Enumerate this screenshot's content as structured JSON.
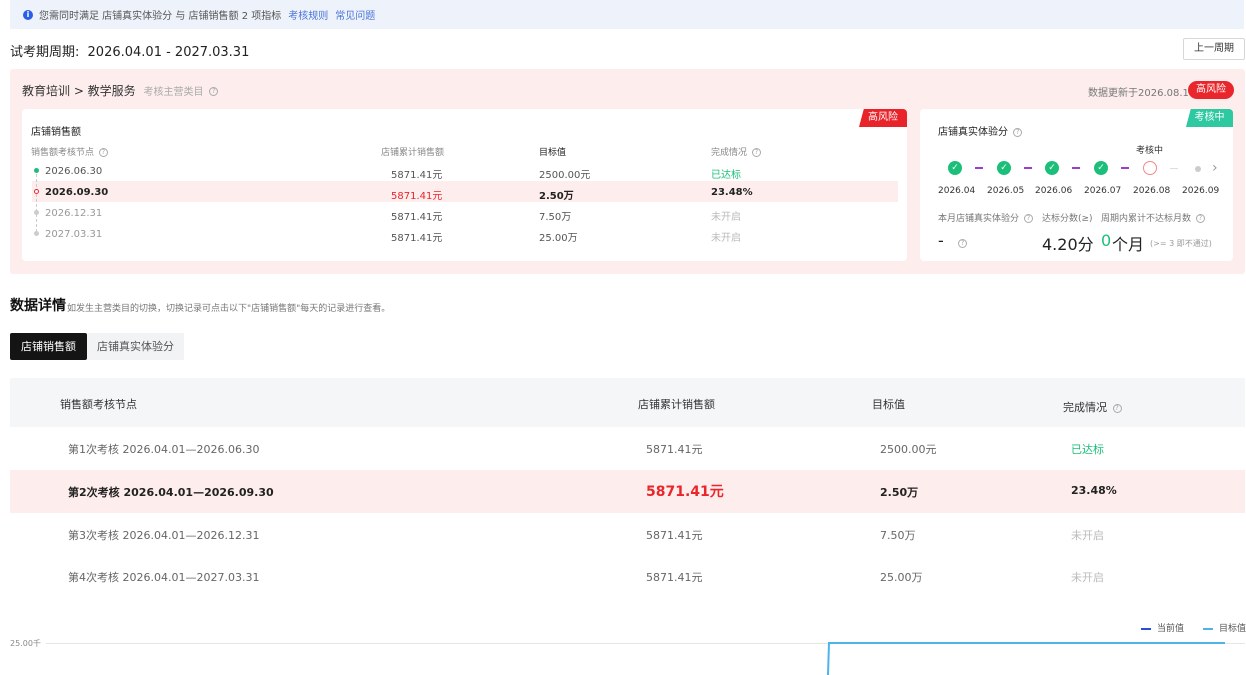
{
  "notice": {
    "text": "您需同时满足 店铺真实体验分 与 店铺销售额 2 项指标",
    "link_rules": "考核规则",
    "link_faq": "常见问题"
  },
  "period": {
    "label": "试考期周期:",
    "range": "2026.04.01 - 2027.03.31",
    "prev_button": "上一周期"
  },
  "summary": {
    "breadcrumb": "教育培训 > 教学服务",
    "breadcrumb_sub": "考核主营类目",
    "updated": "数据更新于2026.08.16",
    "risk_badge": "高风险"
  },
  "sales_card": {
    "corner_badge": "高风险",
    "title": "店铺销售额",
    "headers": [
      "销售额考核节点",
      "店铺累计销售额",
      "目标值",
      "完成情况"
    ],
    "rows": [
      {
        "node": "2026.06.30",
        "sales": "5871.41元",
        "target": "2500.00元",
        "status": "已达标"
      },
      {
        "node": "2026.09.30",
        "sales": "5871.41元",
        "target": "2.50万",
        "status": "23.48%"
      },
      {
        "node": "2026.12.31",
        "sales": "5871.41元",
        "target": "7.50万",
        "status": "未开启"
      },
      {
        "node": "2027.03.31",
        "sales": "5871.41元",
        "target": "25.00万",
        "status": "未开启"
      }
    ]
  },
  "exp_card": {
    "corner_badge": "考核中",
    "title": "店铺真实体验分",
    "current_label": "考核中",
    "months": [
      "2026.04",
      "2026.05",
      "2026.06",
      "2026.07",
      "2026.08",
      "2026.09"
    ],
    "stat_labels": [
      "本月店铺真实体验分",
      "达标分数(≥)",
      "周期内累计不达标月数"
    ],
    "score": "-",
    "threshold": "4.20分",
    "fail_count": "0",
    "fail_unit": "个月",
    "fail_note": "(>= 3 即不通过)"
  },
  "details": {
    "title": "数据详情",
    "desc": "如发生主营类目的切换，切换记录可点击以下\"店铺销售额\"每天的记录进行查看。",
    "tabs": [
      "店铺销售额",
      "店铺真实体验分"
    ],
    "headers": [
      "销售额考核节点",
      "店铺累计销售额",
      "目标值",
      "完成情况"
    ],
    "rows": [
      {
        "node": "第1次考核 2026.04.01—2026.06.30",
        "sales": "5871.41元",
        "target": "2500.00元",
        "status": "已达标"
      },
      {
        "node": "第2次考核 2026.04.01—2026.09.30",
        "sales": "5871.41元",
        "target": "2.50万",
        "status": "23.48%"
      },
      {
        "node": "第3次考核 2026.04.01—2026.12.31",
        "sales": "5871.41元",
        "target": "7.50万",
        "status": "未开启"
      },
      {
        "node": "第4次考核 2026.04.01—2027.03.31",
        "sales": "5871.41元",
        "target": "25.00万",
        "status": "未开启"
      }
    ]
  },
  "colors": {
    "red": "#e8262b",
    "green": "#1cbf7a",
    "teal": "#2ec9a1",
    "current_line": "#2a4fd6",
    "target_line": "#4fb3e8"
  },
  "chart_data": {
    "type": "line",
    "legend": [
      "当前值",
      "目标值"
    ],
    "ytick": "25.00千",
    "series": [
      {
        "name": "当前值",
        "values": []
      },
      {
        "name": "目标值",
        "values": [
          25.0
        ]
      }
    ]
  }
}
